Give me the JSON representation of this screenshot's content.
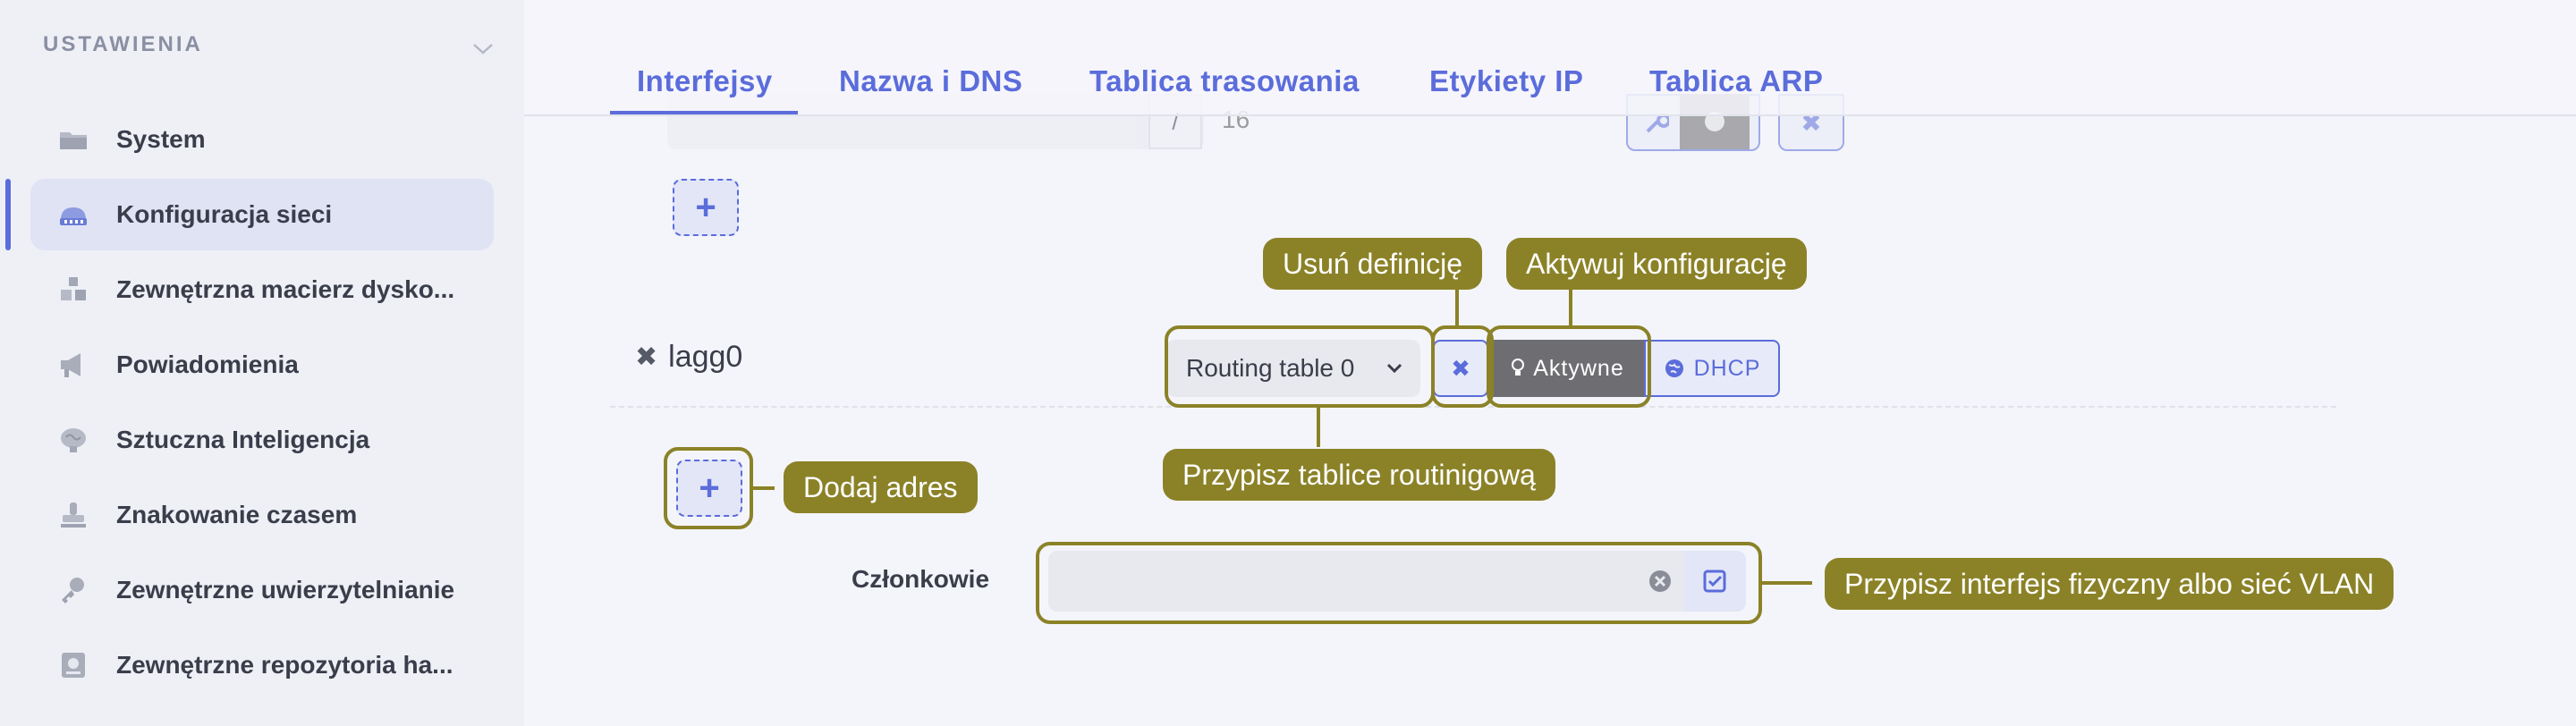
{
  "sidebar": {
    "header": "USTAWIENIA",
    "items": [
      {
        "label": "System",
        "icon": "folder-icon"
      },
      {
        "label": "Konfiguracja sieci",
        "icon": "network-icon"
      },
      {
        "label": "Zewnętrzna macierz dysko...",
        "icon": "disk-array-icon"
      },
      {
        "label": "Powiadomienia",
        "icon": "megaphone-icon"
      },
      {
        "label": "Sztuczna Inteligencja",
        "icon": "brain-icon"
      },
      {
        "label": "Znakowanie czasem",
        "icon": "stamp-icon"
      },
      {
        "label": "Zewnętrzne uwierzytelnianie",
        "icon": "key-icon"
      },
      {
        "label": "Zewnętrzne repozytoria ha...",
        "icon": "vault-icon"
      }
    ],
    "active_index": 1
  },
  "tabs": [
    {
      "label": "Interfejsy",
      "active": true
    },
    {
      "label": "Nazwa i DNS",
      "active": false
    },
    {
      "label": "Tablica trasowania",
      "active": false
    },
    {
      "label": "Etykiety IP",
      "active": false
    },
    {
      "label": "Tablica ARP",
      "active": false
    }
  ],
  "top_row": {
    "separator": "/",
    "prefix": "16"
  },
  "lagg": {
    "name": "lagg0",
    "routing_table": "Routing table 0",
    "active_label": "Aktywne",
    "dhcp_label": "DHCP",
    "members_label": "Członkowie",
    "members_value": ""
  },
  "annotations": {
    "delete_definition": "Usuń definicję",
    "activate_config": "Aktywuj konfigurację",
    "assign_routing": "Przypisz tablice routinigową",
    "add_address": "Dodaj adres",
    "assign_interface": "Przypisz interfejs fizyczny albo sieć VLAN"
  },
  "colors": {
    "accent": "#5b6cdb",
    "annotation": "#8b8228",
    "active_button": "#6e6e72"
  }
}
